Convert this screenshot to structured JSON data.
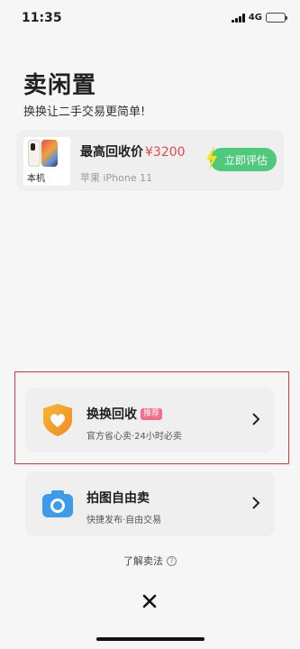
{
  "status_bar": {
    "time": "11:35",
    "network": "4G"
  },
  "header": {
    "title": "卖闲置",
    "subtitle": "换换让二手交易更简单!"
  },
  "device_card": {
    "tag": "本机",
    "price_label": "最高回收价",
    "price": "¥3200",
    "model": "苹果 iPhone 11",
    "button_label": "立即评估",
    "button_color": "#4fca7c",
    "price_color": "#e5484d"
  },
  "options": [
    {
      "title": "换换回收",
      "badge": "推荐",
      "desc": "官方省心卖·24小时必卖",
      "icon": "shield-heart-icon"
    },
    {
      "title": "拍图自由卖",
      "desc": "快捷发布·自由交易",
      "icon": "camera-icon"
    }
  ],
  "footer": {
    "learn_link": "了解卖法",
    "close_icon": "close-icon"
  }
}
